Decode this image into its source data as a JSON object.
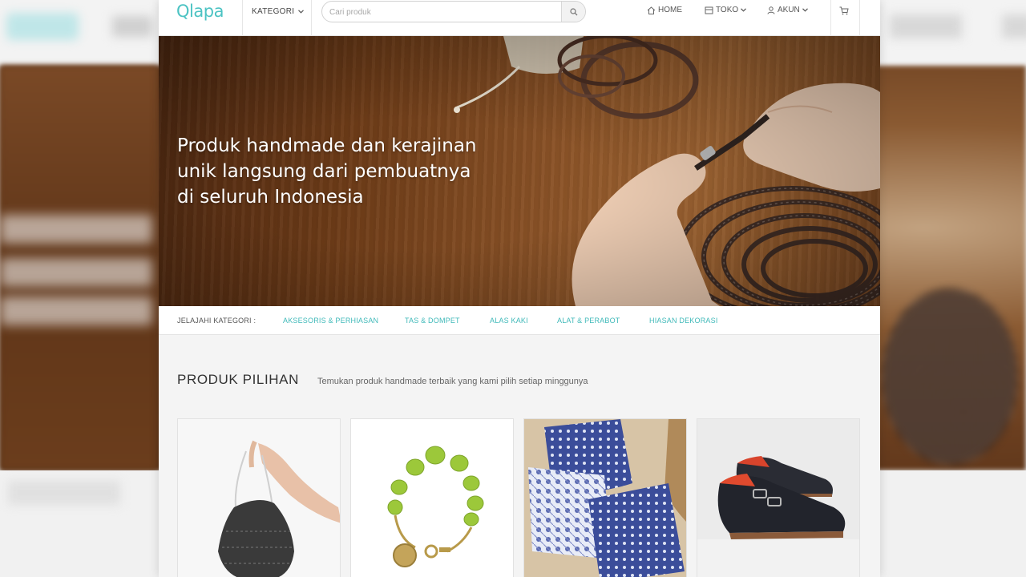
{
  "header": {
    "logo": "Qlapa",
    "kategori_label": "KATEGORI",
    "search": {
      "placeholder": "Cari produk"
    },
    "nav": {
      "home": "HOME",
      "toko": "TOKO",
      "akun": "AKUN"
    }
  },
  "hero": {
    "headline": "Produk handmade dan kerajinan\nunik langsung dari pembuatnya\ndi seluruh Indonesia"
  },
  "category_bar": {
    "label": "JELAJAHI KATEGORI :",
    "items": [
      {
        "label": "AKSESORIS & PERHIASAN"
      },
      {
        "label": "TAS & DOMPET"
      },
      {
        "label": "ALAS KAKI"
      },
      {
        "label": "ALAT & PERABOT"
      },
      {
        "label": "HIASAN DEKORASI"
      }
    ]
  },
  "featured": {
    "title": "PRODUK PILIHAN",
    "description": "Temukan produk handmade terbaik yang kami pilih setiap minggunya"
  },
  "products": [
    {
      "image": "black-patterned-bag"
    },
    {
      "image": "green-stone-bracelet"
    },
    {
      "image": "blue-batik-pillows"
    },
    {
      "image": "leather-monk-shoes"
    }
  ],
  "colors": {
    "brand": "#4cc3c3",
    "category_link": "#3fb9b9"
  },
  "icons": {
    "search": "search-icon",
    "home": "home-icon",
    "toko": "store-icon",
    "akun": "user-icon",
    "cart": "cart-icon"
  }
}
